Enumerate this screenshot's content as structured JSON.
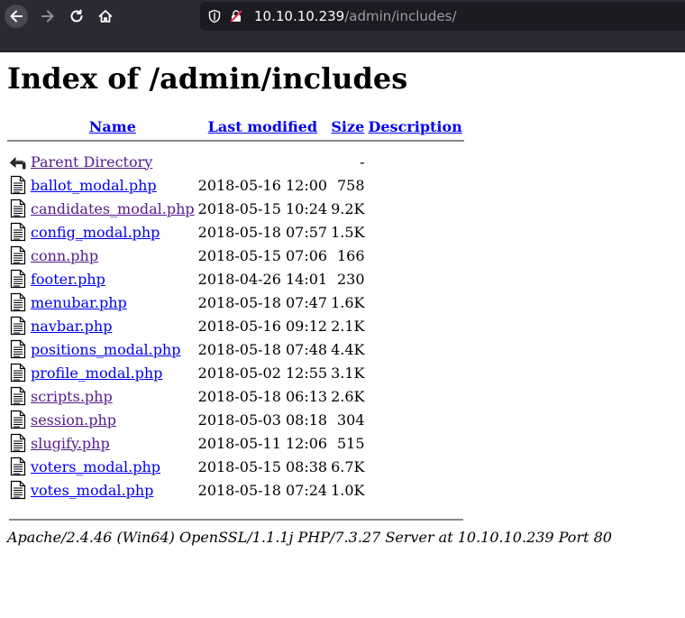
{
  "browser": {
    "url_host": "10.10.10.239",
    "url_path": "/admin/includes/"
  },
  "page": {
    "title": "Index of /admin/includes"
  },
  "columns": {
    "name": "Name",
    "last_modified": "Last modified",
    "size": "Size",
    "description": "Description"
  },
  "parent": {
    "label": "Parent Directory",
    "size": "-"
  },
  "files": [
    {
      "name": "ballot_modal.php",
      "modified": "2018-05-16 12:00",
      "size": "758",
      "visited": false
    },
    {
      "name": "candidates_modal.php",
      "modified": "2018-05-15 10:24",
      "size": "9.2K",
      "visited": true
    },
    {
      "name": "config_modal.php",
      "modified": "2018-05-18 07:57",
      "size": "1.5K",
      "visited": false
    },
    {
      "name": "conn.php",
      "modified": "2018-05-15 07:06",
      "size": "166",
      "visited": true
    },
    {
      "name": "footer.php",
      "modified": "2018-04-26 14:01",
      "size": "230",
      "visited": false
    },
    {
      "name": "menubar.php",
      "modified": "2018-05-18 07:47",
      "size": "1.6K",
      "visited": false
    },
    {
      "name": "navbar.php",
      "modified": "2018-05-16 09:12",
      "size": "2.1K",
      "visited": false
    },
    {
      "name": "positions_modal.php",
      "modified": "2018-05-18 07:48",
      "size": "4.4K",
      "visited": false
    },
    {
      "name": "profile_modal.php",
      "modified": "2018-05-02 12:55",
      "size": "3.1K",
      "visited": false
    },
    {
      "name": "scripts.php",
      "modified": "2018-05-18 06:13",
      "size": "2.6K",
      "visited": true
    },
    {
      "name": "session.php",
      "modified": "2018-05-03 08:18",
      "size": "304",
      "visited": true
    },
    {
      "name": "slugify.php",
      "modified": "2018-05-11 12:06",
      "size": "515",
      "visited": true
    },
    {
      "name": "voters_modal.php",
      "modified": "2018-05-15 08:38",
      "size": "6.7K",
      "visited": false
    },
    {
      "name": "votes_modal.php",
      "modified": "2018-05-18 07:24",
      "size": "1.0K",
      "visited": false
    }
  ],
  "footer": {
    "server_signature": "Apache/2.4.46 (Win64) OpenSSL/1.1.1j PHP/7.3.27 Server at 10.10.10.239 Port 80"
  }
}
